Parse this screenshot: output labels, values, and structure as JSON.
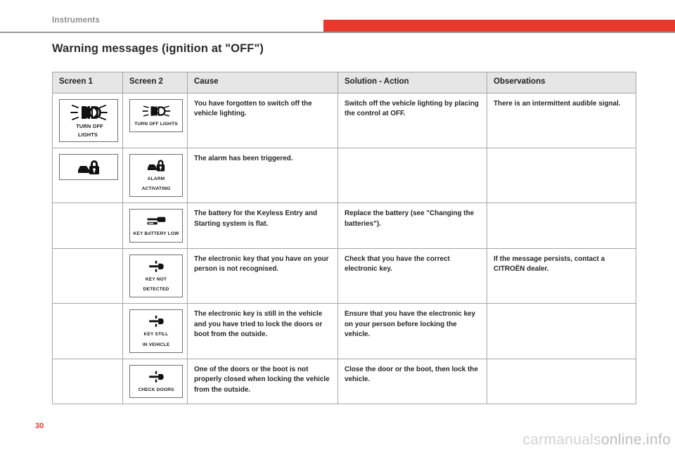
{
  "header": {
    "section_label": "Instruments",
    "accent_color": "#e8382c"
  },
  "title": "Warning messages (ignition at \"OFF\")",
  "table": {
    "columns": [
      {
        "key": "screen1",
        "label": "Screen 1"
      },
      {
        "key": "screen2",
        "label": "Screen 2"
      },
      {
        "key": "cause",
        "label": "Cause"
      },
      {
        "key": "solution",
        "label": "Solution - Action"
      },
      {
        "key": "observations",
        "label": "Observations"
      }
    ],
    "rows": [
      {
        "screen1": {
          "icon": "headlights-icon",
          "caption_line1": "TURN OFF",
          "caption_line2": "LIGHTS"
        },
        "screen2": {
          "icon": "headlights-icon",
          "caption": "TURN OFF LIGHTS"
        },
        "cause": "You have forgotten to switch off the vehicle lighting.",
        "solution": "Switch off the vehicle lighting by placing the control at OFF.",
        "observations": "There is an intermittent audible signal."
      },
      {
        "screen1": {
          "icon": "car-padlock-alarm-icon",
          "caption": ""
        },
        "screen2": {
          "icon": "car-padlock-alarm-icon",
          "caption": "ALARM ACTIVATING"
        },
        "cause": "The alarm has been triggered.",
        "solution": "",
        "observations": ""
      },
      {
        "screen1": {
          "icon": "",
          "caption": ""
        },
        "screen2": {
          "icon": "key-battery-icon",
          "caption": "KEY BATTERY LOW"
        },
        "cause": "The battery for the Keyless Entry and Starting system is flat.",
        "solution": "Replace the battery (see \"Changing the batteries\").",
        "observations": ""
      },
      {
        "screen1": {
          "icon": "",
          "caption": ""
        },
        "screen2": {
          "icon": "key-signal-icon",
          "caption": "KEY NOT DETECTED"
        },
        "cause": "The electronic key that you have on your person is not recognised.",
        "solution": "Check that you have the correct electronic key.",
        "observations": "If the message persists, contact a CITROËN dealer."
      },
      {
        "screen1": {
          "icon": "",
          "caption": ""
        },
        "screen2": {
          "icon": "key-signal-icon",
          "caption": "KEY STILL\nIN VEHICLE"
        },
        "cause": "The electronic key is still in the vehicle and you have tried to lock the doors or boot from the outside.",
        "solution": "Ensure that you have the electronic key on your person before locking the vehicle.",
        "observations": ""
      },
      {
        "screen1": {
          "icon": "",
          "caption": ""
        },
        "screen2": {
          "icon": "key-signal-icon",
          "caption": "CHECK DOORS"
        },
        "cause": "One of the doors or the boot is not properly closed when locking the vehicle from the outside.",
        "solution": "Close the door or the boot, then lock the vehicle.",
        "observations": ""
      }
    ]
  },
  "footer": {
    "page_number": "30",
    "watermark_light": "carmanuals",
    "watermark_bold": "online.info"
  }
}
